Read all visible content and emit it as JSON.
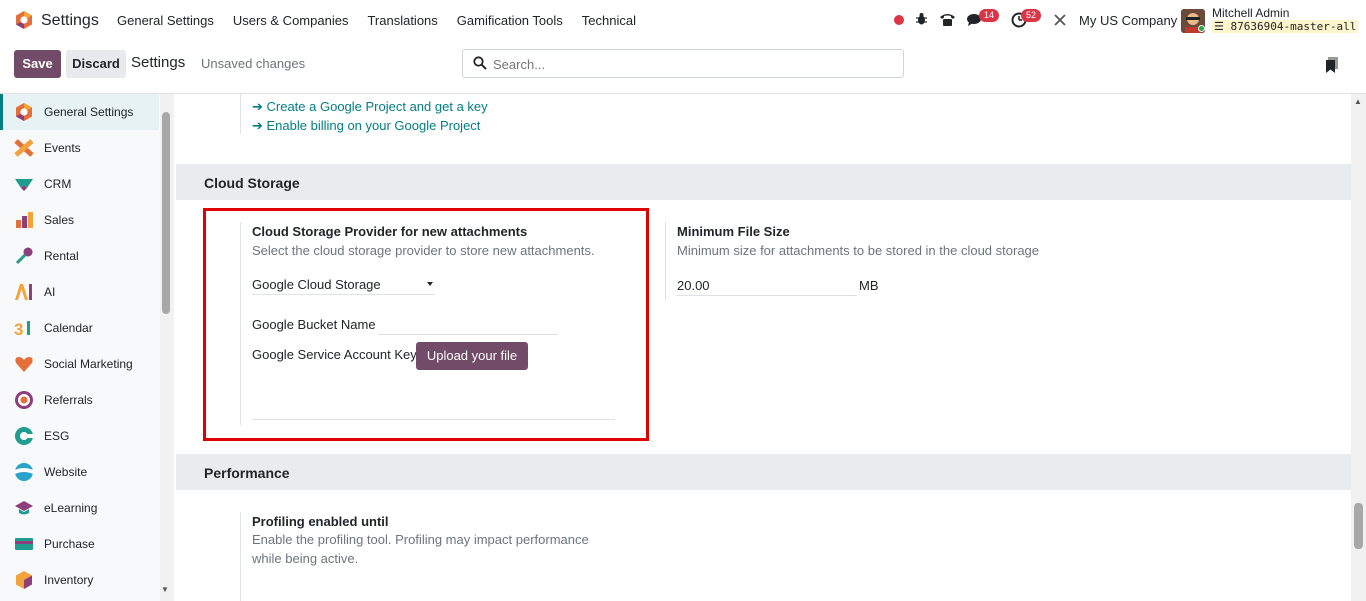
{
  "navbar": {
    "app_title": "Settings",
    "menu": [
      "General Settings",
      "Users & Companies",
      "Translations",
      "Gamification Tools",
      "Technical"
    ],
    "chat_badge": "14",
    "activity_badge": "52",
    "company": "My US Company",
    "user_name": "Mitchell Admin",
    "db_name": "87636904-master-all",
    "accent_color": "#714b67"
  },
  "controlpanel": {
    "save_label": "Save",
    "discard_label": "Discard",
    "title": "Settings",
    "status": "Unsaved changes",
    "search_placeholder": "Search..."
  },
  "sidebar": {
    "items": [
      {
        "label": "General Settings",
        "icon": "settings-app-icon"
      },
      {
        "label": "Events",
        "icon": "events-app-icon"
      },
      {
        "label": "CRM",
        "icon": "crm-app-icon"
      },
      {
        "label": "Sales",
        "icon": "sales-app-icon"
      },
      {
        "label": "Rental",
        "icon": "rental-app-icon"
      },
      {
        "label": "AI",
        "icon": "ai-app-icon"
      },
      {
        "label": "Calendar",
        "icon": "calendar-app-icon"
      },
      {
        "label": "Social Marketing",
        "icon": "social-marketing-app-icon"
      },
      {
        "label": "Referrals",
        "icon": "referrals-app-icon"
      },
      {
        "label": "ESG",
        "icon": "esg-app-icon"
      },
      {
        "label": "Website",
        "icon": "website-app-icon"
      },
      {
        "label": "eLearning",
        "icon": "elearning-app-icon"
      },
      {
        "label": "Purchase",
        "icon": "purchase-app-icon"
      },
      {
        "label": "Inventory",
        "icon": "inventory-app-icon"
      }
    ]
  },
  "main": {
    "links": [
      "➔ Create a Google Project and get a key",
      "➔ Enable billing on your Google Project"
    ],
    "cloud_storage": {
      "section_title": "Cloud Storage",
      "provider_title": "Cloud Storage Provider for new attachments",
      "provider_desc": "Select the cloud storage provider to store new attachments.",
      "provider_value": "Google Cloud Storage",
      "bucket_label": "Google Bucket Name",
      "bucket_value": "",
      "key_label": "Google Service Account Key",
      "upload_label": "Upload your file",
      "min_title": "Minimum File Size",
      "min_desc": "Minimum size for attachments to be stored in the cloud storage",
      "min_value": "20.00",
      "min_unit": "MB"
    },
    "performance": {
      "section_title": "Performance",
      "profiling_title": "Profiling enabled until",
      "profiling_desc_1": "Enable the profiling tool. Profiling may impact performance",
      "profiling_desc_2": "while being active."
    }
  }
}
